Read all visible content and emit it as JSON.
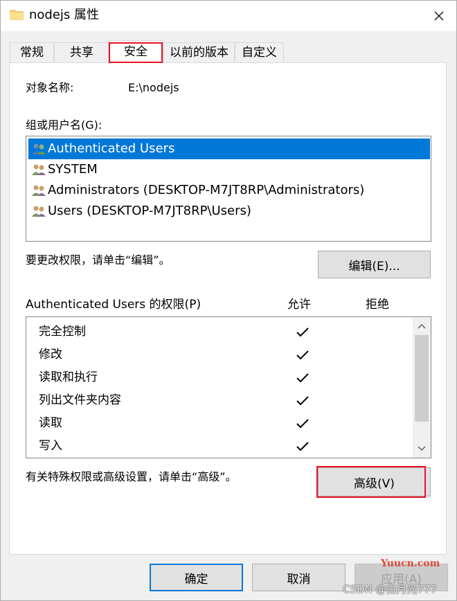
{
  "window": {
    "title": "nodejs 属性",
    "close_glyph": "✕"
  },
  "tabs": [
    {
      "label": "常规",
      "active": false
    },
    {
      "label": "共享",
      "active": false
    },
    {
      "label": "安全",
      "active": true
    },
    {
      "label": "以前的版本",
      "active": false
    },
    {
      "label": "自定义",
      "active": false
    }
  ],
  "security": {
    "object_name_label": "对象名称:",
    "object_name_value": "E:\\nodejs",
    "groups_label": "组或用户名(G):",
    "groups": [
      {
        "name": "Authenticated Users",
        "selected": true
      },
      {
        "name": "SYSTEM",
        "selected": false
      },
      {
        "name": "Administrators (DESKTOP-M7JT8RP\\Administrators)",
        "selected": false
      },
      {
        "name": "Users (DESKTOP-M7JT8RP\\Users)",
        "selected": false
      }
    ],
    "edit_hint": "要更改权限，请单击“编辑”。",
    "edit_button": "编辑(E)...",
    "permissions_label": "Authenticated Users 的权限(P)",
    "allow_header": "允许",
    "deny_header": "拒绝",
    "permissions": [
      {
        "name": "完全控制",
        "allow": true,
        "deny": false
      },
      {
        "name": "修改",
        "allow": true,
        "deny": false
      },
      {
        "name": "读取和执行",
        "allow": true,
        "deny": false
      },
      {
        "name": "列出文件夹内容",
        "allow": true,
        "deny": false
      },
      {
        "name": "读取",
        "allow": true,
        "deny": false
      },
      {
        "name": "写入",
        "allow": true,
        "deny": false
      }
    ],
    "advanced_hint": "有关特殊权限或高级设置，请单击“高级”。",
    "advanced_button": "高级(V)"
  },
  "footer": {
    "ok_button": "确定",
    "cancel_button": "取消",
    "apply_button": "应用(A)"
  },
  "watermarks": {
    "site": "Yuucn.com",
    "author": "CSDN @白月光777"
  },
  "colors": {
    "selection": "#0078d7",
    "highlight_box": "#e81224",
    "folder": "#f8d775"
  }
}
